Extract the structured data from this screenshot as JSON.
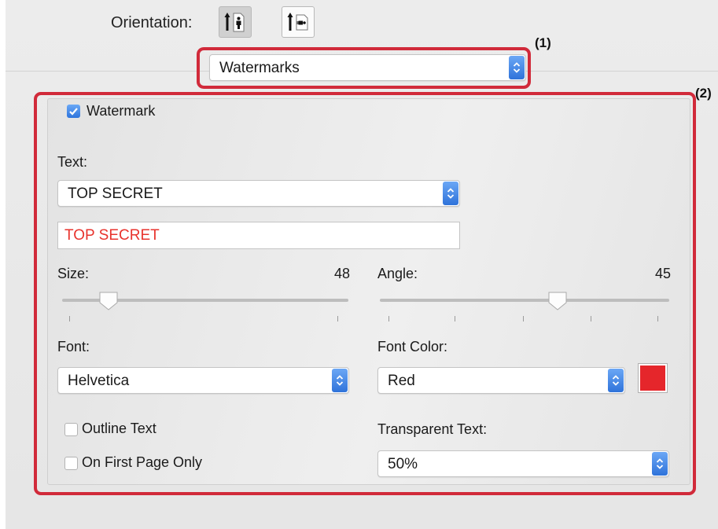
{
  "orientation": {
    "label": "Orientation:",
    "options": [
      {
        "name": "portrait",
        "icon": "portrait-orientation-icon",
        "selected": true
      },
      {
        "name": "landscape",
        "icon": "landscape-orientation-icon",
        "selected": false
      }
    ]
  },
  "section_popup": {
    "value": "Watermarks"
  },
  "callouts": {
    "c1": "(1)",
    "c2": "(2)"
  },
  "watermark": {
    "enable_label": "Watermark",
    "enabled": true,
    "text_label": "Text:",
    "text_preset": "TOP SECRET",
    "text_value": "TOP SECRET",
    "text_color": "#e8332d",
    "size_label": "Size:",
    "size_value": "48",
    "size_slider_fraction": 0.18,
    "angle_label": "Angle:",
    "angle_value": "45",
    "angle_slider_fraction": 0.62,
    "font_label": "Font:",
    "font_value": "Helvetica",
    "font_color_label": "Font Color:",
    "font_color_value": "Red",
    "font_color_swatch": "#e5262b",
    "outline_label": "Outline Text",
    "outline_checked": false,
    "first_page_label": "On First Page Only",
    "first_page_checked": false,
    "transparent_label": "Transparent Text:",
    "transparent_value": "50%"
  },
  "colors": {
    "accent": "#3b80e6",
    "highlight": "#d12a3a"
  }
}
